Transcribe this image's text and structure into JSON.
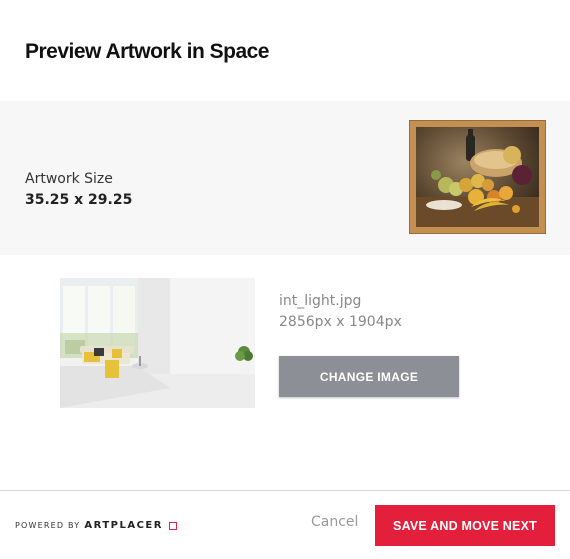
{
  "dialog": {
    "title": "Preview Artwork in Space"
  },
  "artwork": {
    "size_label": "Artwork Size",
    "size_value": "35.25 x 29.25",
    "frame_color": "#c48f53"
  },
  "space": {
    "file_name": "int_light.jpg",
    "file_dimensions": "2856px x 1904px",
    "change_button_label": "CHANGE IMAGE"
  },
  "footer": {
    "powered_prefix": "POWERED BY",
    "powered_brand": "ARTPLACER",
    "cancel_label": "Cancel",
    "save_label": "SAVE AND MOVE NEXT",
    "accent_color": "#e41f3c"
  }
}
